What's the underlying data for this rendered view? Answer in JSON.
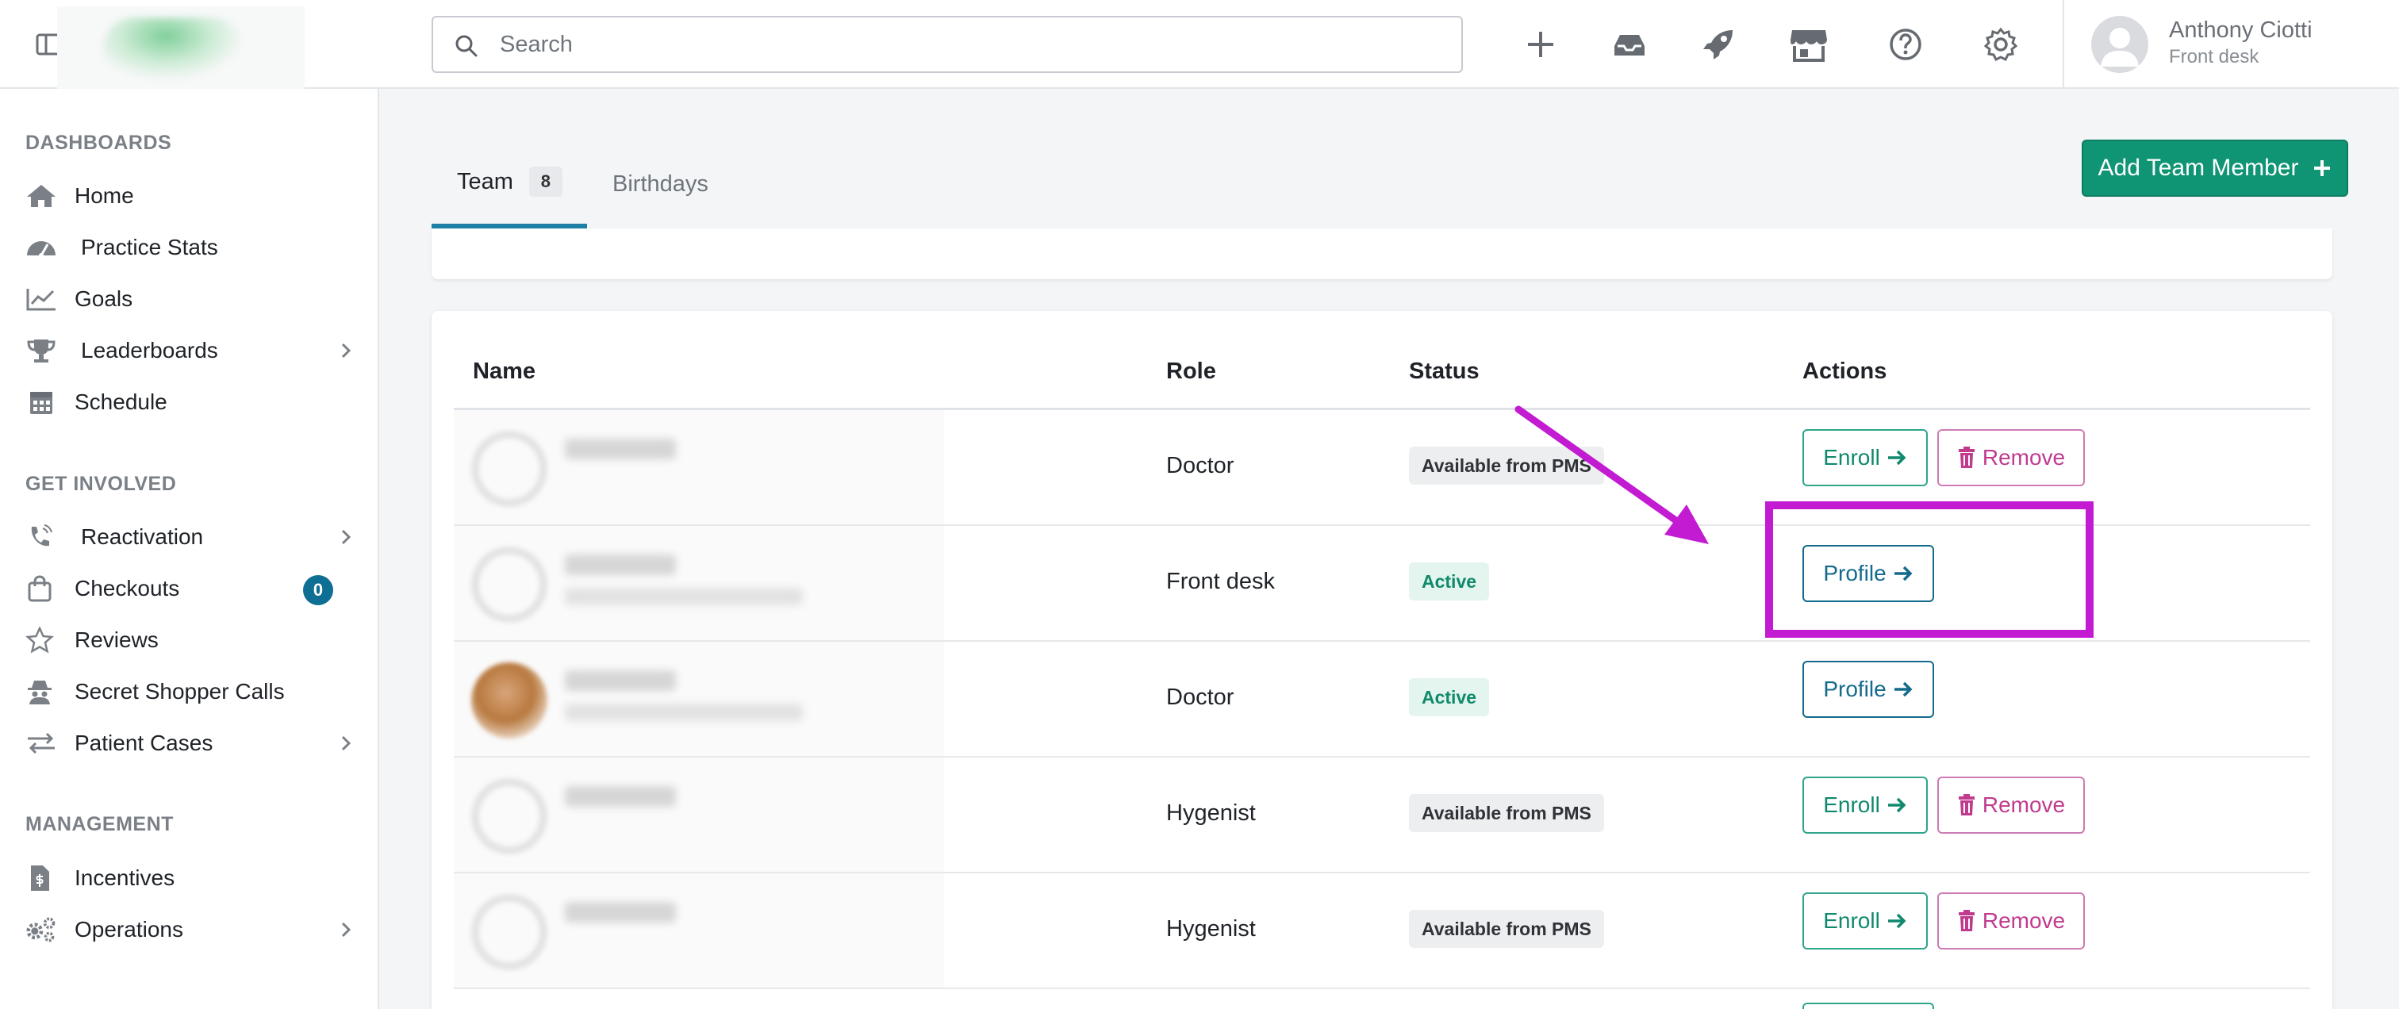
{
  "topbar": {
    "search_placeholder": "Search",
    "icons": [
      "plus-icon",
      "inbox-icon",
      "rocket-icon",
      "store-icon",
      "help-icon",
      "gear-icon"
    ],
    "user": {
      "name": "Anthony Ciotti",
      "role": "Front desk"
    }
  },
  "sidebar": {
    "sections": [
      {
        "title": "DASHBOARDS"
      },
      {
        "title": "GET INVOLVED"
      },
      {
        "title": "MANAGEMENT"
      }
    ],
    "items": [
      {
        "label": "Home",
        "icon": "home-icon"
      },
      {
        "label": "Practice Stats",
        "icon": "gauge-icon"
      },
      {
        "label": "Goals",
        "icon": "line-chart-icon"
      },
      {
        "label": "Leaderboards",
        "icon": "trophy-icon",
        "expandable": true
      },
      {
        "label": "Schedule",
        "icon": "calendar-icon"
      },
      {
        "label": "Reactivation",
        "icon": "phone-icon",
        "expandable": true
      },
      {
        "label": "Checkouts",
        "icon": "shopping-bag-icon",
        "badge": "0"
      },
      {
        "label": "Reviews",
        "icon": "star-icon"
      },
      {
        "label": "Secret Shopper Calls",
        "icon": "spy-icon"
      },
      {
        "label": "Patient Cases",
        "icon": "exchange-icon",
        "expandable": true
      },
      {
        "label": "Incentives",
        "icon": "invoice-dollar-icon"
      },
      {
        "label": "Operations",
        "icon": "gears-icon",
        "expandable": true
      }
    ]
  },
  "tabs": [
    {
      "label": "Team",
      "count": "8",
      "active": true
    },
    {
      "label": "Birthdays"
    }
  ],
  "add_button": {
    "label": "Add Team Member"
  },
  "table": {
    "columns": [
      "Name",
      "Role",
      "Status",
      "Actions"
    ],
    "rows": [
      {
        "role": "Doctor",
        "status": "Available from PMS",
        "status_type": "pms",
        "actions": [
          "Enroll",
          "Remove"
        ]
      },
      {
        "role": "Front desk",
        "status": "Active",
        "status_type": "active",
        "actions": [
          "Profile"
        ]
      },
      {
        "role": "Doctor",
        "status": "Active",
        "status_type": "active",
        "actions": [
          "Profile"
        ]
      },
      {
        "role": "Hygenist",
        "status": "Available from PMS",
        "status_type": "pms",
        "actions": [
          "Enroll",
          "Remove"
        ]
      },
      {
        "role": "Hygenist",
        "status": "Available from PMS",
        "status_type": "pms",
        "actions": [
          "Enroll",
          "Remove"
        ]
      }
    ]
  },
  "colors": {
    "accent_green": "#0f9474",
    "profile_blue": "#146a8c",
    "remove_pink": "#c03a8e",
    "annotation_magenta": "#c21bd2"
  }
}
